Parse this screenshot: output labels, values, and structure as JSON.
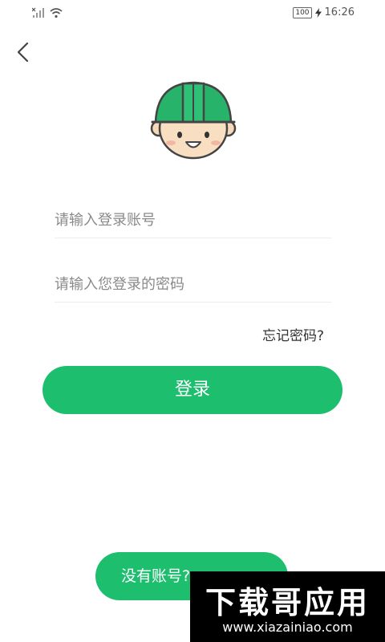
{
  "status_bar": {
    "time": "16:26",
    "battery": "100",
    "icons": [
      "signal-icon",
      "wifi-icon",
      "battery-icon",
      "charging-icon"
    ]
  },
  "header": {
    "back_icon": "back-arrow-icon"
  },
  "avatar": {
    "icon": "worker-helmet-avatar",
    "helmet_color": "#27b46a"
  },
  "login_form": {
    "username_placeholder": "请输入登录账号",
    "password_placeholder": "请输入您登录的密码",
    "forgot_password": "忘记密码?",
    "login_button": "登录"
  },
  "footer": {
    "register_button": "没有账号?"
  },
  "watermark": {
    "logo_text": "下载哥应用",
    "url": "www.xiazainiao.com"
  },
  "colors": {
    "accent": "#1dbf6e",
    "background": "#ffffff"
  }
}
